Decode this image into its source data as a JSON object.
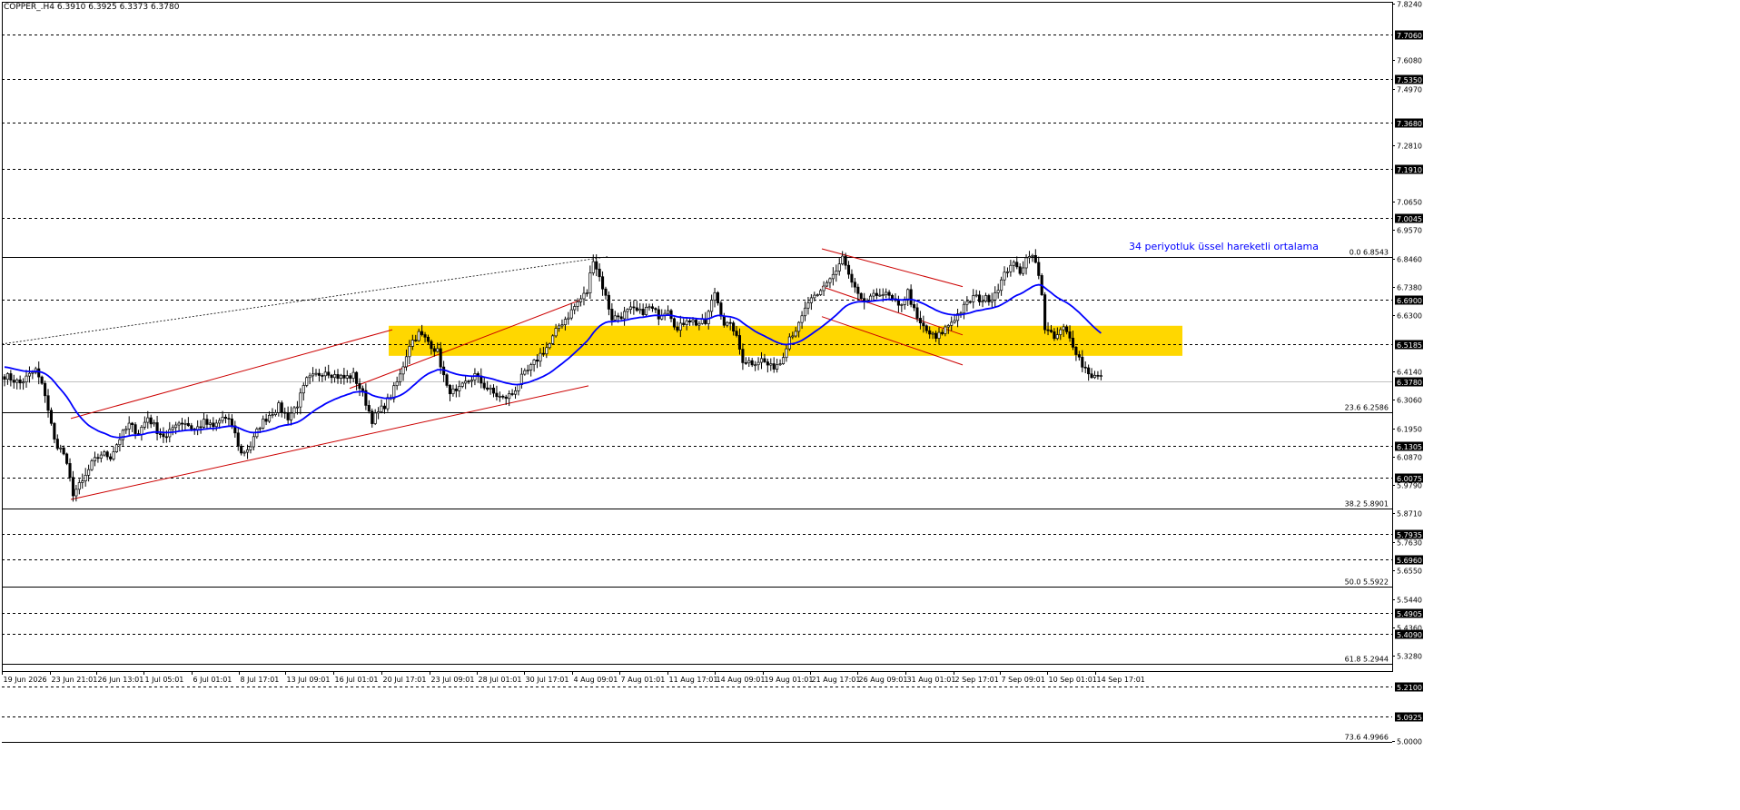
{
  "symbol": "COPPER_.H4",
  "ohlc_header": "6.3910 6.3925 6.3373 6.3780",
  "annotation": "34 periyotluk üssel hareketli ortalama",
  "colors": {
    "background": "#ffffff",
    "candle": "#000000",
    "ema": "#0000ff",
    "zone": "#ffd700",
    "channel": "#cc0000",
    "level_line": "#000000",
    "annotation_text": "#0000ff"
  },
  "chart_data": {
    "type": "candlestick",
    "title": "COPPER_.H4",
    "ylim": [
      5.0,
      7.824
    ],
    "y_ticks": [
      "7.8240",
      "7.6080",
      "7.4970",
      "7.2810",
      "7.0650",
      "6.9570",
      "6.8460",
      "6.7380",
      "6.6300",
      "6.4140",
      "6.3060",
      "6.1950",
      "6.0870",
      "5.9790",
      "5.8710",
      "5.7630",
      "5.6550",
      "5.5440",
      "5.4360",
      "5.3280",
      "5.0000"
    ],
    "x_ticks": [
      "19 Jun 2026",
      "23 Jun 21:01",
      "26 Jun 13:01",
      "1 Jul 05:01",
      "6 Jul 01:01",
      "8 Jul 17:01",
      "13 Jul 09:01",
      "16 Jul 01:01",
      "20 Jul 17:01",
      "23 Jul 09:01",
      "28 Jul 01:01",
      "30 Jul 17:01",
      "4 Aug 09:01",
      "7 Aug 01:01",
      "11 Aug 17:01",
      "14 Aug 09:01",
      "19 Aug 01:01",
      "21 Aug 17:01",
      "26 Aug 09:01",
      "31 Aug 01:01",
      "2 Sep 17:01",
      "7 Sep 09:01",
      "10 Sep 01:01",
      "14 Sep 17:01"
    ],
    "current_price": "6.3780",
    "horizontal_levels": [
      {
        "value": 7.706,
        "label": "7.7060",
        "style": "dashed"
      },
      {
        "value": 7.535,
        "label": "7.5350",
        "style": "dashed"
      },
      {
        "value": 7.368,
        "label": "7.3680",
        "style": "dashed"
      },
      {
        "value": 7.191,
        "label": "7.1910",
        "style": "dashed"
      },
      {
        "value": 7.0045,
        "label": "7.0045",
        "style": "dashed"
      },
      {
        "value": 6.69,
        "label": "6.6900",
        "style": "dashed"
      },
      {
        "value": 6.5185,
        "label": "6.5185",
        "style": "dashed"
      },
      {
        "value": 6.1305,
        "label": "6.1305",
        "style": "dashed"
      },
      {
        "value": 6.0075,
        "label": "6.0075",
        "style": "dashed"
      },
      {
        "value": 5.7935,
        "label": "5.7935",
        "style": "dashed"
      },
      {
        "value": 5.696,
        "label": "5.6960",
        "style": "dashed"
      },
      {
        "value": 5.4905,
        "label": "5.4905",
        "style": "dashed"
      },
      {
        "value": 5.409,
        "label": "5.4090",
        "style": "dashed"
      },
      {
        "value": 5.21,
        "label": "5.2100",
        "style": "dashed"
      },
      {
        "value": 5.0925,
        "label": "5.0925",
        "style": "dashed"
      }
    ],
    "fibonacci": [
      {
        "value": 6.8543,
        "label": "0.0 6.8543"
      },
      {
        "value": 6.2586,
        "label": "23.6 6.2586"
      },
      {
        "value": 5.8901,
        "label": "38.2 5.8901"
      },
      {
        "value": 5.5922,
        "label": "50.0 5.5922"
      },
      {
        "value": 5.2944,
        "label": "61.8 5.2944"
      },
      {
        "value": 4.9966,
        "label": "73.6 4.9966"
      }
    ],
    "zone": {
      "from": 6.475,
      "to": 6.59
    },
    "close_anchors": [
      [
        0,
        6.4
      ],
      [
        5,
        6.37
      ],
      [
        10,
        6.42
      ],
      [
        13,
        6.33
      ],
      [
        16,
        6.15
      ],
      [
        19,
        6.1
      ],
      [
        22,
        5.95
      ],
      [
        25,
        5.99
      ],
      [
        28,
        6.06
      ],
      [
        31,
        6.1
      ],
      [
        34,
        6.09
      ],
      [
        37,
        6.16
      ],
      [
        40,
        6.21
      ],
      [
        43,
        6.18
      ],
      [
        46,
        6.24
      ],
      [
        49,
        6.19
      ],
      [
        52,
        6.16
      ],
      [
        55,
        6.22
      ],
      [
        58,
        6.22
      ],
      [
        61,
        6.19
      ],
      [
        64,
        6.22
      ],
      [
        67,
        6.2
      ],
      [
        70,
        6.24
      ],
      [
        73,
        6.21
      ],
      [
        76,
        6.1
      ],
      [
        79,
        6.13
      ],
      [
        82,
        6.21
      ],
      [
        85,
        6.25
      ],
      [
        88,
        6.28
      ],
      [
        91,
        6.24
      ],
      [
        94,
        6.29
      ],
      [
        97,
        6.38
      ],
      [
        100,
        6.4
      ],
      [
        103,
        6.42
      ],
      [
        106,
        6.4
      ],
      [
        109,
        6.39
      ],
      [
        112,
        6.4
      ],
      [
        115,
        6.33
      ],
      [
        118,
        6.23
      ],
      [
        121,
        6.27
      ],
      [
        124,
        6.32
      ],
      [
        127,
        6.4
      ],
      [
        130,
        6.52
      ],
      [
        133,
        6.56
      ],
      [
        136,
        6.53
      ],
      [
        139,
        6.49
      ],
      [
        142,
        6.35
      ],
      [
        145,
        6.33
      ],
      [
        148,
        6.37
      ],
      [
        151,
        6.4
      ],
      [
        154,
        6.36
      ],
      [
        157,
        6.33
      ],
      [
        160,
        6.31
      ],
      [
        163,
        6.33
      ],
      [
        166,
        6.39
      ],
      [
        169,
        6.43
      ],
      [
        172,
        6.48
      ],
      [
        175,
        6.52
      ],
      [
        178,
        6.59
      ],
      [
        181,
        6.63
      ],
      [
        184,
        6.68
      ],
      [
        187,
        6.72
      ],
      [
        189,
        6.85
      ],
      [
        192,
        6.74
      ],
      [
        195,
        6.62
      ],
      [
        198,
        6.63
      ],
      [
        201,
        6.65
      ],
      [
        204,
        6.64
      ],
      [
        207,
        6.66
      ],
      [
        210,
        6.63
      ],
      [
        213,
        6.66
      ],
      [
        216,
        6.57
      ],
      [
        219,
        6.62
      ],
      [
        222,
        6.6
      ],
      [
        225,
        6.6
      ],
      [
        228,
        6.72
      ],
      [
        231,
        6.6
      ],
      [
        234,
        6.58
      ],
      [
        237,
        6.46
      ],
      [
        240,
        6.45
      ],
      [
        243,
        6.46
      ],
      [
        246,
        6.43
      ],
      [
        249,
        6.45
      ],
      [
        252,
        6.55
      ],
      [
        255,
        6.59
      ],
      [
        258,
        6.68
      ],
      [
        261,
        6.7
      ],
      [
        264,
        6.76
      ],
      [
        267,
        6.8
      ],
      [
        269,
        6.85
      ],
      [
        272,
        6.75
      ],
      [
        275,
        6.68
      ],
      [
        278,
        6.69
      ],
      [
        281,
        6.72
      ],
      [
        284,
        6.7
      ],
      [
        287,
        6.66
      ],
      [
        290,
        6.72
      ],
      [
        293,
        6.61
      ],
      [
        296,
        6.57
      ],
      [
        299,
        6.54
      ],
      [
        302,
        6.58
      ],
      [
        305,
        6.62
      ],
      [
        308,
        6.66
      ],
      [
        311,
        6.7
      ],
      [
        314,
        6.69
      ],
      [
        317,
        6.7
      ],
      [
        320,
        6.76
      ],
      [
        323,
        6.83
      ],
      [
        326,
        6.8
      ],
      [
        329,
        6.87
      ],
      [
        331,
        6.83
      ],
      [
        333,
        6.72
      ],
      [
        334,
        6.58
      ],
      [
        337,
        6.54
      ],
      [
        340,
        6.58
      ],
      [
        343,
        6.52
      ],
      [
        346,
        6.44
      ],
      [
        349,
        6.4
      ],
      [
        352,
        6.39
      ]
    ],
    "ema_period": 34
  }
}
